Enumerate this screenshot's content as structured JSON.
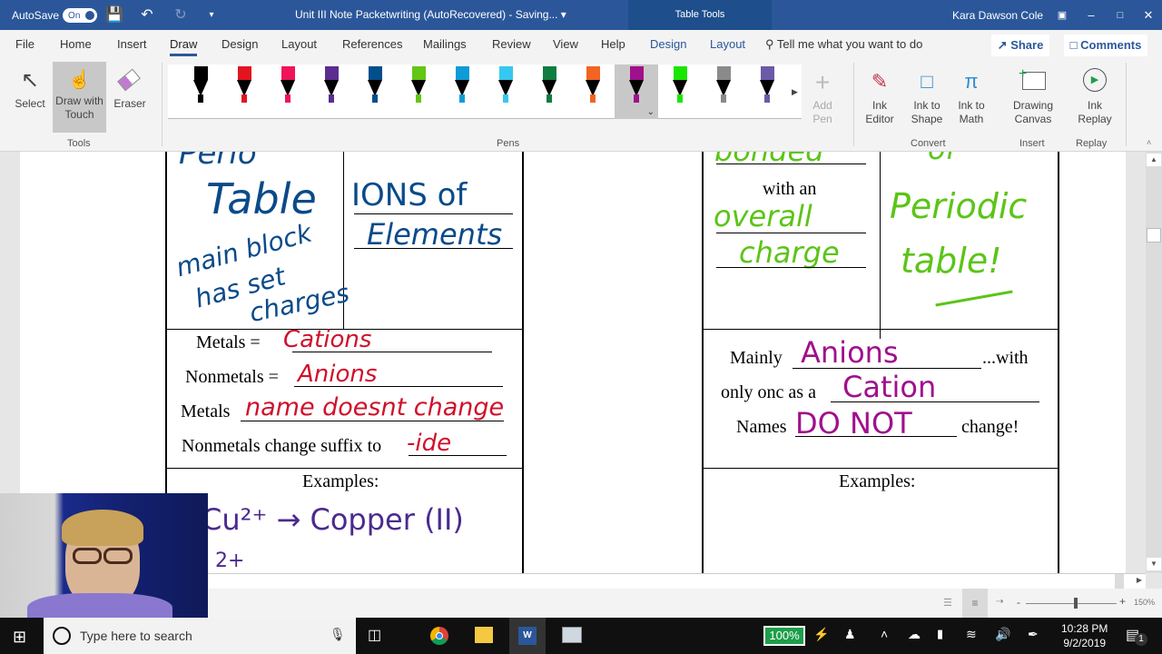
{
  "titlebar": {
    "autosave_label": "AutoSave",
    "autosave_state": "On",
    "doc_title": "Unit III Note Packetwriting (AutoRecovered)  -  Saving...",
    "context_tab": "Table Tools",
    "user_name": "Kara Dawson Cole"
  },
  "menu": {
    "tabs": [
      "File",
      "Home",
      "Insert",
      "Draw",
      "Design",
      "Layout",
      "References",
      "Mailings",
      "Review",
      "View",
      "Help",
      "Design",
      "Layout"
    ],
    "active_tab": "Draw",
    "tell_me": "Tell me what you want to do",
    "share": "Share",
    "comments": "Comments"
  },
  "ribbon": {
    "tools": {
      "select": "Select",
      "draw_with_touch": "Draw with Touch",
      "eraser": "Eraser",
      "group": "Tools"
    },
    "pens": {
      "group": "Pens",
      "add_pen": "Add Pen",
      "colors": [
        "#000000",
        "#e3141f",
        "#f0145a",
        "#5a2d91",
        "#004e8c",
        "#62c614",
        "#0f9bd7",
        "#36c8f0",
        "#107c41",
        "#f26422",
        "#a0108c",
        "#19e600",
        "#8a8a8a",
        "#6a5aa8"
      ],
      "selected_index": 10
    },
    "convert": {
      "ink_editor": "Ink Editor",
      "ink_to_shape": "Ink to Shape",
      "ink_to_math": "Ink to Math",
      "group": "Convert"
    },
    "insert": {
      "drawing_canvas": "Drawing Canvas",
      "group": "Insert"
    },
    "replay": {
      "ink_replay": "Ink Replay",
      "group": "Replay"
    }
  },
  "document": {
    "left_table": {
      "ink_top_left_1": "Table",
      "ink_top_left_2": "main block",
      "ink_top_left_3": "has set",
      "ink_top_left_4": "charges",
      "ink_top_right_1": "IONS of",
      "ink_top_right_2": "Elements",
      "metals_label": "Metals =",
      "metals_ink": "Cations",
      "nonmetals_label": "Nonmetals =",
      "nonmetals_ink": "Anions",
      "metals2_label": "Metals",
      "metals2_ink": "name doesnt change",
      "suffix_label": "Nonmetals change suffix to",
      "suffix_ink": "-ide",
      "examples_label": "Examples:",
      "example1_ink": "Cu²⁺ → Copper (II)",
      "example2_ink": "2+"
    },
    "right_table": {
      "ink_bonded": "bonded",
      "with_an": "with an",
      "ink_overall": "overall",
      "ink_charge": "charge",
      "ink_periodic": "Periodic",
      "ink_table": "table!",
      "mainly_label": "Mainly",
      "mainly_ink": "Anions",
      "with_label": "...with",
      "only_label": "only onc as a",
      "only_ink": "Cation",
      "names_label": "Names",
      "names_ink": "DO NOT",
      "change_label": "change!",
      "examples_label": "Examples:"
    },
    "ink_colors": {
      "blue": "#0a4a8a",
      "red": "#d0102a",
      "green": "#5cc418",
      "magenta": "#a0108c",
      "purple": "#4a2a90"
    }
  },
  "statusbar": {
    "zoom": "150%"
  },
  "taskbar": {
    "search_placeholder": "Type here to search",
    "battery": "100%",
    "time": "10:28 PM",
    "date": "9/2/2019",
    "notifications": "1"
  }
}
